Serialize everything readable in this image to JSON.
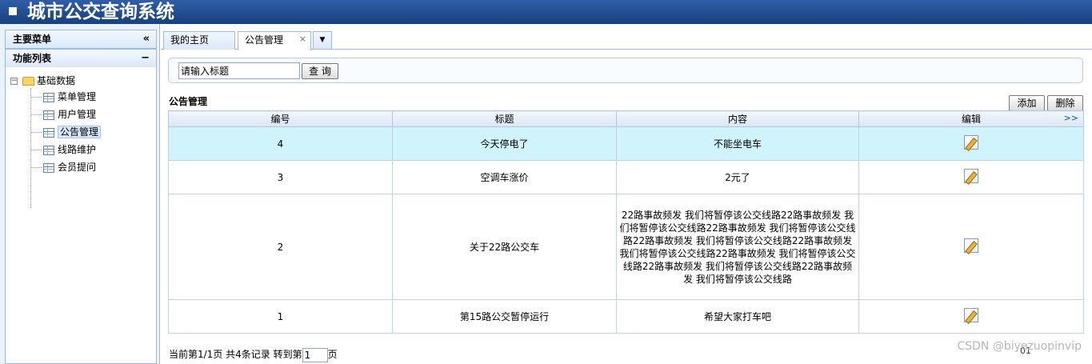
{
  "app": {
    "title": "城市公交查询系统"
  },
  "sidebar": {
    "main_menu": "主要菜单",
    "collapse_glyph": "«",
    "func_list": "功能列表",
    "func_toggle": "−",
    "tree_root": "基础数据",
    "items": [
      {
        "label": "菜单管理"
      },
      {
        "label": "用户管理"
      },
      {
        "label": "公告管理"
      },
      {
        "label": "线路维护"
      },
      {
        "label": "会员提问"
      }
    ]
  },
  "tabs": [
    {
      "label": "我的主页"
    },
    {
      "label": "公告管理",
      "close": "×"
    }
  ],
  "tab_dropdown_glyph": "▼",
  "search": {
    "value": "请输入标题",
    "button": "查 询"
  },
  "section_title": "公告管理",
  "actions": {
    "add": "添加",
    "delete": "删除"
  },
  "table": {
    "columns": [
      "编号",
      "标题",
      "内容",
      "编辑"
    ],
    "more_glyph": ">>",
    "rows": [
      {
        "id": "4",
        "title": "今天停电了",
        "content": "不能坐电车"
      },
      {
        "id": "3",
        "title": "空调车涨价",
        "content": "2元了"
      },
      {
        "id": "2",
        "title": "关于22路公交车",
        "content": "22路事故频发 我们将暂停该公交线路22路事故频发 我们将暂停该公交线路22路事故频发 我们将暂停该公交线路22路事故频发 我们将暂停该公交线路22路事故频发 我们将暂停该公交线路22路事故频发 我们将暂停该公交线路22路事故频发 我们将暂停该公交线路22路事故频发 我们将暂停该公交线路"
      },
      {
        "id": "1",
        "title": "第15路公交暂停运行",
        "content": "希望大家打车吧"
      }
    ]
  },
  "pager": {
    "status": "当前第1/1页 共4条记录 转到第",
    "page_input": "1",
    "page_suffix": "页",
    "page_indicator": "01"
  },
  "watermark": "CSDN @biyezuopinvip"
}
